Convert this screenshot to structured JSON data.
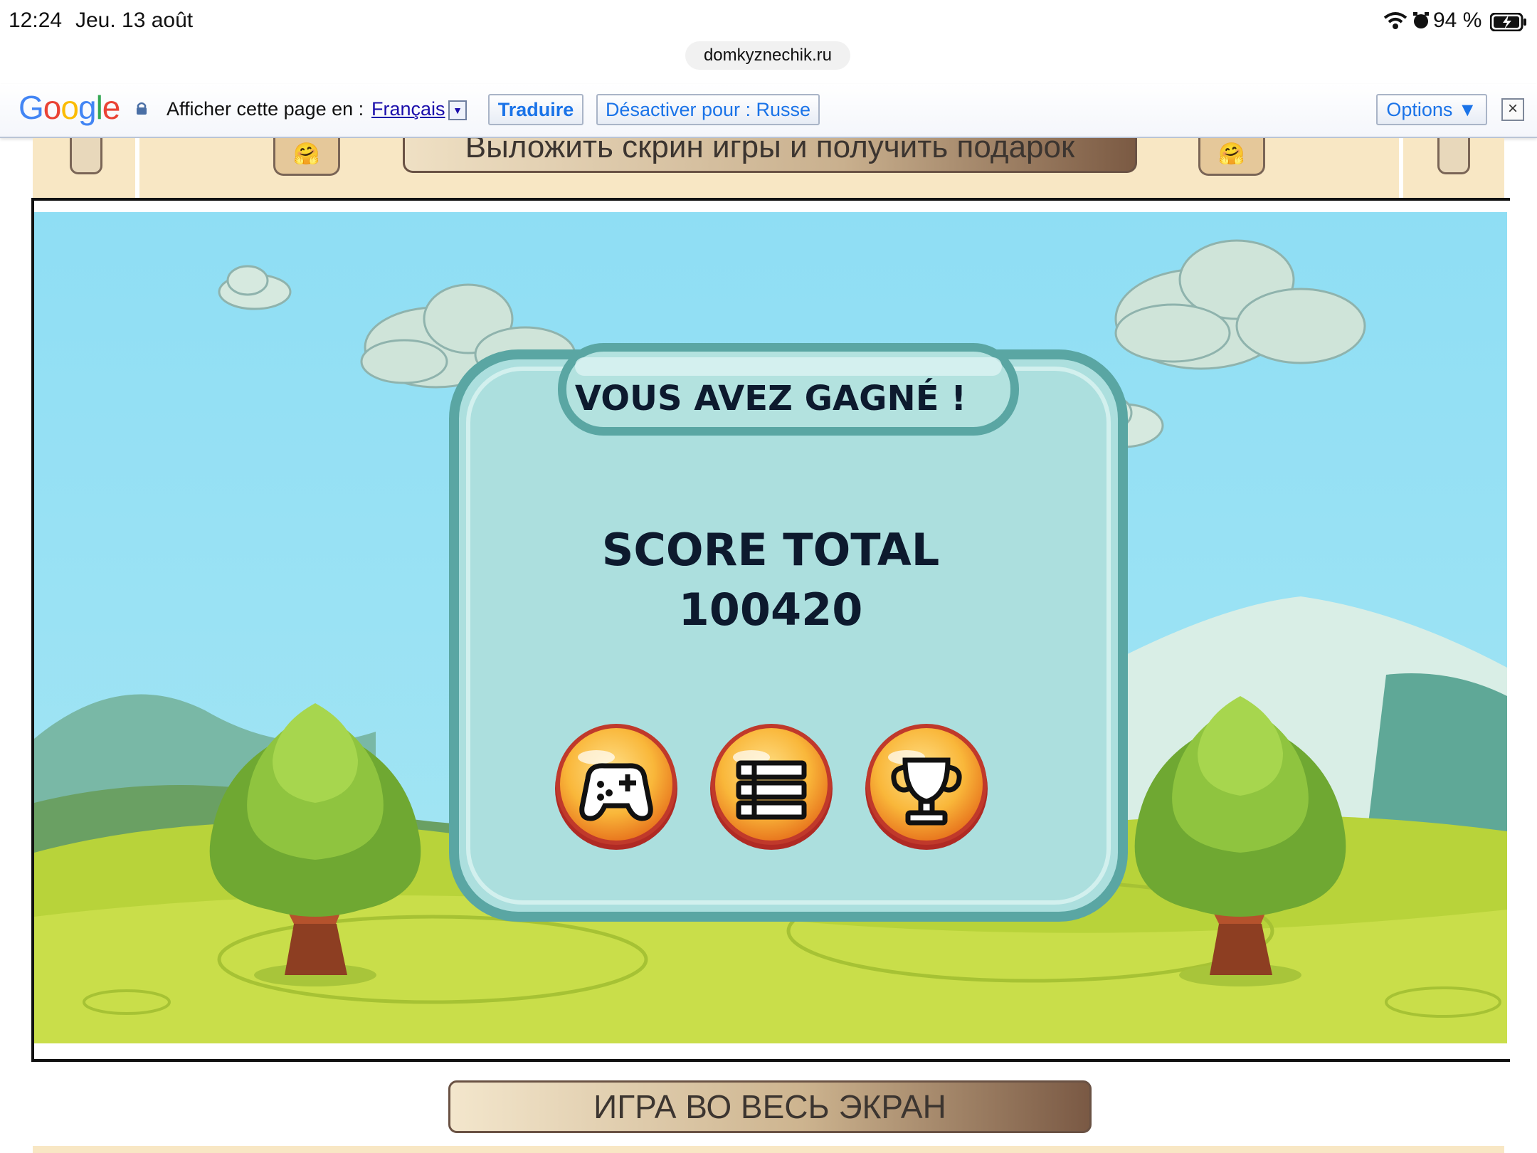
{
  "status_bar": {
    "time": "12:24",
    "date": "Jeu. 13 août",
    "battery": "94 %",
    "url": "domkyznechik.ru"
  },
  "translate_bar": {
    "logo": "Google",
    "prompt": "Afficher cette page en :",
    "language": "Français",
    "translate_button": "Traduire",
    "disable_button": "Désactiver pour : Russe",
    "options_button": "Options ▼",
    "close": "×"
  },
  "site": {
    "top_button": "Выложить скрин игры и получить подарок",
    "emoji": "🤗",
    "fullscreen_button": "ИГРА ВО ВЕСЬ ЭКРАН"
  },
  "game": {
    "panel_title": "VOUS AVEZ GAGNÉ !",
    "score_label": "SCORE TOTAL",
    "score_value": "100420",
    "buttons": [
      "play-again-icon",
      "menu-list-icon",
      "trophy-icon"
    ]
  },
  "colors": {
    "sky": "#8fdcf2",
    "panel": "#acdfde",
    "panel_border": "#5aa6a3",
    "grass": "#b8d33a",
    "button_orange": "#f5a623",
    "link_blue": "#1a73e8"
  }
}
